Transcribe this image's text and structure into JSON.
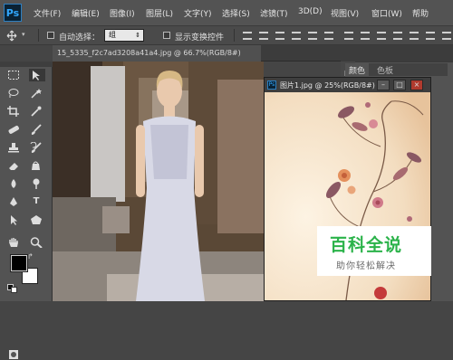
{
  "app": {
    "logo": "Ps"
  },
  "menu": [
    "文件(F)",
    "编辑(E)",
    "图像(I)",
    "图层(L)",
    "文字(Y)",
    "选择(S)",
    "滤镜(T)",
    "3D(D)",
    "视图(V)",
    "窗口(W)",
    "帮助"
  ],
  "options_bar": {
    "auto_select_label": "自动选择：",
    "auto_select_value": "组",
    "show_transform_label": "显示变换控件"
  },
  "tabs": {
    "main_doc": "15_5335_f2c7ad3208a41a4.jpg @ 66.7%(RGB/8#)"
  },
  "floating_doc": {
    "title": "图片1.jpg @ 25%(RGB/8#)",
    "win_buttons": [
      "–",
      "□",
      "×"
    ]
  },
  "panels": {
    "tab1": "颜色",
    "tab2": "色板"
  },
  "watermark": {
    "title": "百科全说",
    "subtitle": "助你轻松解决"
  },
  "colors": {
    "foreground": "#000000",
    "background": "#ffffff",
    "accent": "#31a8ff",
    "watermark_green": "#2bb34a"
  },
  "icons": [
    "move-icon",
    "marquee-icon",
    "lasso-icon",
    "magic-wand-icon",
    "crop-icon",
    "eyedropper-icon",
    "healing-brush-icon",
    "brush-icon",
    "clone-stamp-icon",
    "history-brush-icon",
    "eraser-icon",
    "gradient-icon",
    "blur-icon",
    "dodge-icon",
    "pen-icon",
    "type-icon",
    "path-selection-icon",
    "shape-icon",
    "hand-icon",
    "zoom-icon"
  ]
}
